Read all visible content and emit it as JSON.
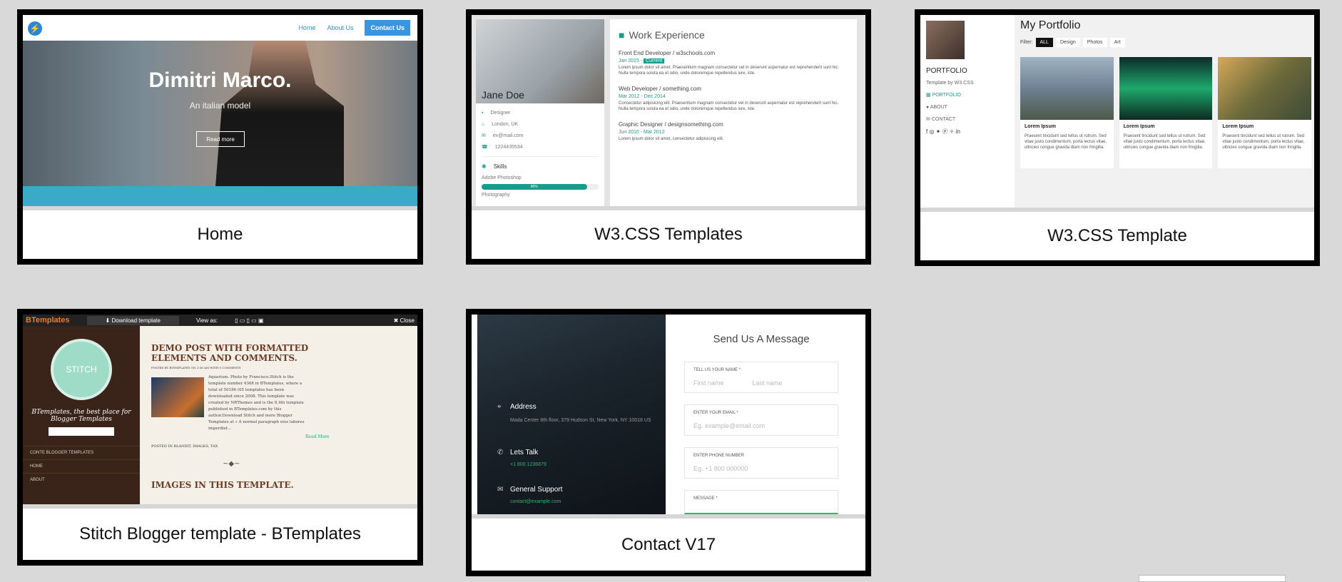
{
  "cards": [
    {
      "caption": "Home",
      "nav": [
        "Home",
        "About Us",
        "Contact Us"
      ],
      "hero_title": "Dimitri Marco.",
      "hero_subtitle": "An italian model",
      "hero_button": "Read more"
    },
    {
      "caption": "W3.CSS Templates",
      "name": "Jane Doe",
      "info": [
        "Designer",
        "London, UK",
        "ex@mail.com",
        "1224435534"
      ],
      "skills_title": "Skills",
      "skill_label": "Adobe Photoshop",
      "skill_percent": "90%",
      "skill_label2": "Photography",
      "section_title": "Work Experience",
      "jobs": [
        {
          "title": "Front End Developer / w3schools.com",
          "date": "Jan 2015 - ",
          "badge": "Current",
          "text": "Lorem ipsum dolor sit amet. Praesentium magnam consectetur vel in deserunt aspernatur est reprehenderit sunt hic. Nulla tempora soluta ea et odio, unde doloremque repellendus iure, iste."
        },
        {
          "title": "Web Developer / something.com",
          "date": "Mar 2012 - Dec 2014",
          "badge": "",
          "text": "Consectetur adipisicing elit. Praesentium magnam consectetur vel in deserunt aspernatur est reprehenderit sunt hic. Nulla tempora soluta ea et odio, unde doloremque repellendus iure, iste."
        },
        {
          "title": "Graphic Designer / designsomething.com",
          "date": "Jun 2010 - Mar 2012",
          "badge": "",
          "text": "Lorem ipsum dolor sit amet, consectetur adipisicing elit."
        }
      ]
    },
    {
      "caption": "W3.CSS Template",
      "page_title": "My Portfolio",
      "side_title": "PORTFOLIO",
      "side_sub": "Template by W3.CSS",
      "side_links": [
        "PORTFOLIO",
        "ABOUT",
        "CONTACT"
      ],
      "filter_label": "Filter:",
      "filters": [
        "ALL",
        "Design",
        "Photos",
        "Art"
      ],
      "tiles": [
        {
          "title": "Lorem Ipsum",
          "text": "Praesent tincidunt sed tellus ut rutrum. Sed vitae justo condimentum, porta lectus vitae, ultricies congue gravida diam non fringilla."
        },
        {
          "title": "Lorem Ipsum",
          "text": "Praesent tincidunt sed tellus ut rutrum. Sed vitae justo condimentum, porta lectus vitae, ultricies congue gravida diam non fringilla."
        },
        {
          "title": "Lorem Ipsum",
          "text": "Praesent tincidunt sed tellus ut rutrum. Sed vitae justo condimentum, porta lectus vitae, ultricies congue gravida diam non fringilla."
        }
      ]
    },
    {
      "caption": "Stitch Blogger template - BTemplates",
      "brand": "BTemplates",
      "download": "Download template",
      "view_as": "View as:",
      "close": "Close",
      "blog_name": "STITCH",
      "tagline": "BTemplates, the best place for Blogger Templates",
      "menu": [
        "CONTE BLOGGER TEMPLATES",
        "HOME",
        "ABOUT"
      ],
      "post_title": "DEMO POST WITH FORMATTED ELEMENTS AND COMMENTS.",
      "post_meta": "POSTED BY BTEMPLATES ON 3:56 AM WITH 0 COMMENTS",
      "post_text": "Aquarium. Photo by Francisco.Stitch is the template number 4368 in BTemplates, where a total of 50186 (65 templates has been downloaded since 2008. This template was created by NRThemes and is the 8,4th template published in BTemplates.com by this author.Download Stitch and more Blogger Templates at » A normal paragraph eius labores imperdiet...",
      "read_more": "Read More",
      "posted_in": "POSTED IN BLANDIT, IMAGES, TAX",
      "section2": "IMAGES IN THIS TEMPLATE."
    },
    {
      "caption": "Contact V17",
      "form_title": "Send Us A Message",
      "name_label": "TELL US YOUR NAME *",
      "first_ph": "First name",
      "last_ph": "Last name",
      "email_label": "ENTER YOUR EMAIL *",
      "email_ph": "Eg. example@email.com",
      "phone_label": "ENTER PHONE NUMBER",
      "phone_ph": "Eg. +1 800 000000",
      "message_label": "MESSAGE *",
      "address_title": "Address",
      "address_text": "Mada Center 8th floor, 379 Hudson St, New York, NY 10018 US",
      "talk_title": "Lets Talk",
      "talk_text": "+1 800 1236879",
      "support_title": "General Support",
      "support_text": "contact@example.com"
    }
  ]
}
